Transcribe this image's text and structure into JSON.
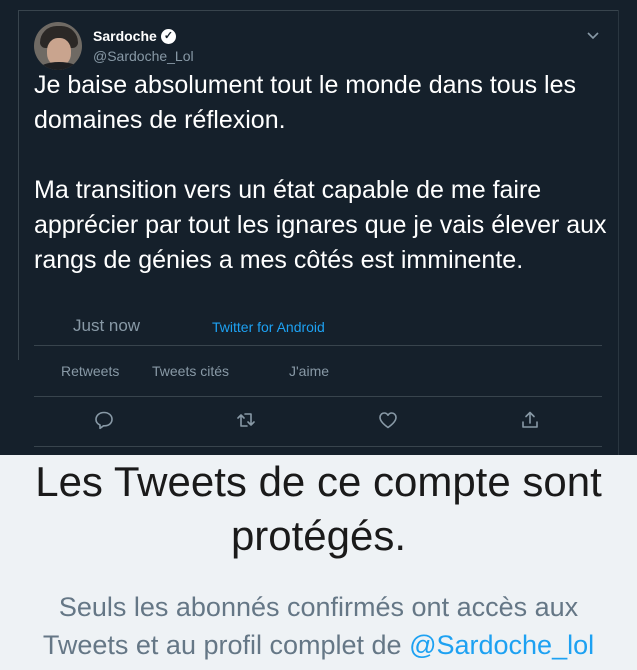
{
  "tweet": {
    "display_name": "Sardoche",
    "handle": "@Sardoche_Lol",
    "text_paragraph_1": "Je baise absolument tout le monde dans tous les domaines de réflexion.",
    "text_paragraph_2": "Ma transition vers un état capable de me faire apprécier par tout les ignares que je vais élever aux rangs de génies a mes côtés est imminente.",
    "timestamp": "Just now",
    "source": "Twitter for Android",
    "stats": {
      "retweets_label": "Retweets",
      "quotes_label": "Tweets cités",
      "likes_label": "J'aime"
    },
    "actions": [
      "reply-icon",
      "retweet-icon",
      "like-icon",
      "share-icon"
    ]
  },
  "notice": {
    "title": "Les Tweets de ce compte sont protégés.",
    "subtitle_part1": "Seuls les abonnés confirmés ont accès aux",
    "subtitle_part2": "Tweets et au profil complet de",
    "subtitle_handle": "@Sardoche_lol"
  },
  "colors": {
    "tweet_background": "#15202b",
    "accent": "#1da1f2",
    "secondary_text": "#8899a6",
    "notice_background": "#eef2f5"
  }
}
